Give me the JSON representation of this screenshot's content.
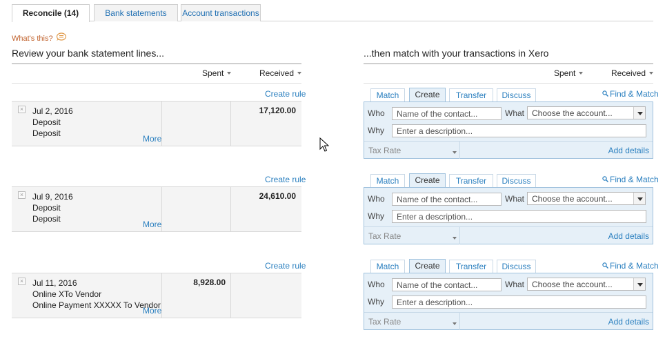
{
  "tabs": [
    {
      "label": "Reconcile (14)",
      "active": true
    },
    {
      "label": "Bank statements",
      "active": false
    },
    {
      "label": "Account transactions",
      "active": false
    }
  ],
  "whats_this": "What's this?",
  "left_heading": "Review your bank statement lines...",
  "right_heading": "...then match with your transactions in Xero",
  "columns": {
    "spent": "Spent",
    "received": "Received"
  },
  "create_rule": "Create rule",
  "more": "More",
  "statement_lines": [
    {
      "date": "Jul 2, 2016",
      "payee": "Deposit",
      "reference": "Deposit",
      "spent": "",
      "received": "17,120.00"
    },
    {
      "date": "Jul 9, 2016",
      "payee": "Deposit",
      "reference": "Deposit",
      "spent": "",
      "received": "24,610.00"
    },
    {
      "date": "Jul 11, 2016",
      "payee": "Online XTo Vendor",
      "reference": "Online Payment XXXXX To Vendor",
      "spent": "8,928.00",
      "received": ""
    }
  ],
  "match_tabs": [
    "Match",
    "Create",
    "Transfer",
    "Discuss"
  ],
  "find_match": "Find & Match",
  "form": {
    "who_label": "Who",
    "who_placeholder": "Name of the contact...",
    "what_label": "What",
    "what_placeholder": "Choose the account...",
    "why_label": "Why",
    "why_placeholder": "Enter a description...",
    "tax_rate": "Tax Rate",
    "add_details": "Add details"
  },
  "colors": {
    "link": "#2a7fbf",
    "accent_orange": "#c0602a",
    "panel_bg": "#e6f0f8"
  }
}
